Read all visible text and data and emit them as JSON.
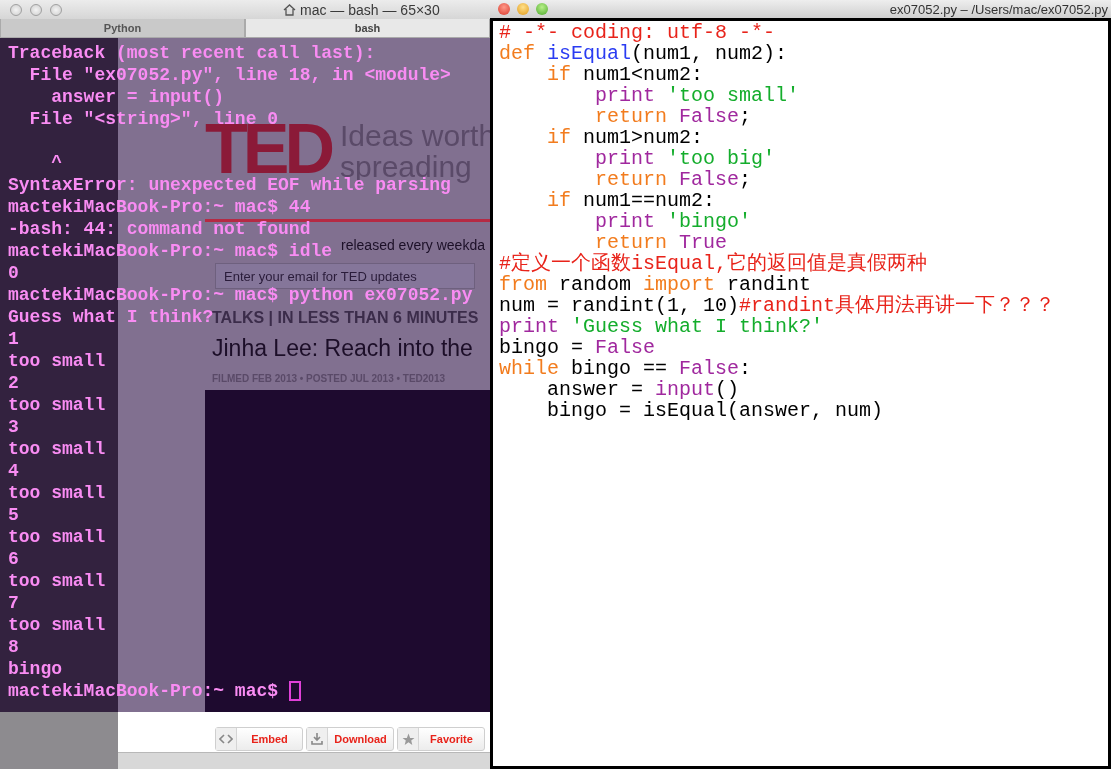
{
  "terminal": {
    "title": "mac — bash — 65×30",
    "tabs": [
      {
        "label": "Python",
        "selected": false
      },
      {
        "label": "bash",
        "selected": true
      }
    ],
    "lines": [
      {
        "text": "Traceback (most recent call last):"
      },
      {
        "text": "  File \"ex07052.py\", line 18, in <module>"
      },
      {
        "text": "    answer = input()"
      },
      {
        "text": "  File \"<string>\", line 0"
      },
      {
        "text": "    ^",
        "blank_line_before": true
      },
      {
        "text": "SyntaxError: unexpected EOF while parsing"
      },
      {
        "text": "mactekiMacBook-Pro:~ mac$ 44"
      },
      {
        "text": "-bash: 44: command not found"
      },
      {
        "text": "mactekiMacBook-Pro:~ mac$ idle"
      },
      {
        "text": "0"
      },
      {
        "text": "mactekiMacBook-Pro:~ mac$ python ex07052.py"
      },
      {
        "text": "Guess what I think?"
      },
      {
        "text": "1"
      },
      {
        "text": "too small"
      },
      {
        "text": "2"
      },
      {
        "text": "too small"
      },
      {
        "text": "3"
      },
      {
        "text": "too small"
      },
      {
        "text": "4"
      },
      {
        "text": "too small"
      },
      {
        "text": "5"
      },
      {
        "text": "too small"
      },
      {
        "text": "6"
      },
      {
        "text": "too small"
      },
      {
        "text": "7"
      },
      {
        "text": "too small"
      },
      {
        "text": "8"
      },
      {
        "text": "bingo"
      },
      {
        "text": "mactekiMacBook-Pro:~ mac$",
        "cursor": true
      }
    ]
  },
  "browser": {
    "logo": "TED",
    "tagline_1": "Ideas worth",
    "tagline_2": "spreading",
    "newsletter": "released every weekda",
    "email_placeholder": "Enter your email for TED updates",
    "section": "TALKS | IN LESS THAN 6 MINUTES",
    "talk_title": "Jinha Lee: Reach into the",
    "meta": "FILMED FEB 2013 • POSTED JUL 2013 • TED2013",
    "buttons": [
      {
        "kind": "code",
        "label": "Embed"
      },
      {
        "kind": "download",
        "label": "Download"
      },
      {
        "kind": "star",
        "label": "Favorite"
      }
    ]
  },
  "editor": {
    "title": "ex07052.py – /Users/mac/ex07052.py",
    "lines": [
      [
        {
          "kind": "comment",
          "text": "# -*- coding: utf-8 -*-"
        }
      ],
      [
        {
          "kind": "keyword",
          "text": "def"
        },
        {
          "kind": "function",
          "text": " isEqual"
        },
        {
          "kind": "plain",
          "text": "(num1, num2):"
        }
      ],
      [
        {
          "kind": "keyword",
          "text": "    if"
        },
        {
          "kind": "plain",
          "text": " num1<num2:"
        }
      ],
      [
        {
          "kind": "builtin",
          "text": "        print"
        },
        {
          "kind": "string",
          "text": " 'too small'"
        }
      ],
      [
        {
          "kind": "keyword",
          "text": "        return"
        },
        {
          "kind": "builtin",
          "text": " False"
        },
        {
          "kind": "plain",
          "text": ";"
        }
      ],
      [
        {
          "kind": "keyword",
          "text": "    if"
        },
        {
          "kind": "plain",
          "text": " num1>num2:"
        }
      ],
      [
        {
          "kind": "builtin",
          "text": "        print"
        },
        {
          "kind": "string",
          "text": " 'too big'"
        }
      ],
      [
        {
          "kind": "keyword",
          "text": "        return"
        },
        {
          "kind": "builtin",
          "text": " False"
        },
        {
          "kind": "plain",
          "text": ";"
        }
      ],
      [
        {
          "kind": "keyword",
          "text": "    if"
        },
        {
          "kind": "plain",
          "text": " num1==num2:"
        }
      ],
      [
        {
          "kind": "builtin",
          "text": "        print"
        },
        {
          "kind": "string",
          "text": " 'bingo'"
        }
      ],
      [
        {
          "kind": "keyword",
          "text": "        return"
        },
        {
          "kind": "builtin",
          "text": " True"
        }
      ],
      [
        {
          "kind": "comment",
          "text": "#定义一个函数isEqual,它的返回值是真假两种"
        }
      ],
      [
        {
          "kind": "keyword",
          "text": "from"
        },
        {
          "kind": "plain",
          "text": " random "
        },
        {
          "kind": "keyword",
          "text": "import"
        },
        {
          "kind": "plain",
          "text": " randint"
        }
      ],
      [
        {
          "kind": "plain",
          "text": "num = randint(1, 10)"
        },
        {
          "kind": "comment",
          "text": "#randint具体用法再讲一下？？？"
        }
      ],
      [
        {
          "kind": "builtin",
          "text": "print"
        },
        {
          "kind": "string",
          "text": " 'Guess what I think?'"
        }
      ],
      [
        {
          "kind": "plain",
          "text": "bingo = "
        },
        {
          "kind": "builtin",
          "text": "False"
        }
      ],
      [
        {
          "kind": "keyword",
          "text": "while"
        },
        {
          "kind": "plain",
          "text": " bingo == "
        },
        {
          "kind": "builtin",
          "text": "False"
        },
        {
          "kind": "plain",
          "text": ":"
        }
      ],
      [
        {
          "kind": "plain",
          "text": "    answer = "
        },
        {
          "kind": "builtin",
          "text": "input"
        },
        {
          "kind": "plain",
          "text": "()"
        }
      ],
      [
        {
          "kind": "plain",
          "text": "    bingo = isEqual(answer, num)"
        }
      ]
    ]
  }
}
